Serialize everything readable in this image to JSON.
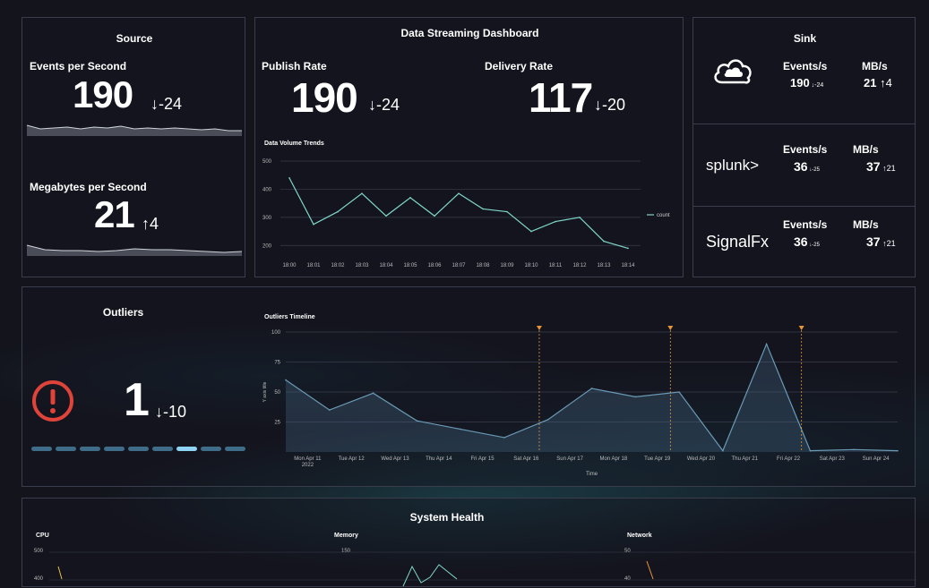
{
  "source": {
    "title": "Source",
    "eps_label": "Events per Second",
    "eps_value": "190",
    "eps_delta": "-24",
    "mbps_label": "Megabytes per Second",
    "mbps_value": "21",
    "mbps_delta": "4"
  },
  "dashboard": {
    "title": "Data Streaming Dashboard",
    "publish_label": "Publish Rate",
    "publish_value": "190",
    "publish_delta": "-24",
    "delivery_label": "Delivery Rate",
    "delivery_value": "117",
    "delivery_delta": "-20"
  },
  "sink": {
    "title": "Sink",
    "events_label": "Events/s",
    "mb_label": "MB/s",
    "rows": [
      {
        "name": "cloud-icon",
        "events": "190",
        "events_delta": "-24",
        "mb": "21",
        "mb_delta": "4"
      },
      {
        "name": "splunk>",
        "events": "36",
        "events_delta": "-25",
        "mb": "37",
        "mb_delta": "21"
      },
      {
        "name": "SignalFx",
        "events": "36",
        "events_delta": "-25",
        "mb": "37",
        "mb_delta": "21"
      }
    ]
  },
  "outliers": {
    "title": "Outliers",
    "value": "1",
    "delta": "-10",
    "icon": "alert-circle-icon",
    "dots_total": 9,
    "dots_active_index": 6
  },
  "system_health": {
    "title": "System Health",
    "cpu_label": "CPU",
    "cpu_ticks": [
      "500",
      "400"
    ],
    "memory_label": "Memory",
    "memory_ticks": [
      "150"
    ],
    "network_label": "Network",
    "network_ticks": [
      "50",
      "40"
    ]
  },
  "colors": {
    "accent": "#7fd6c8",
    "alert": "#e0433a",
    "dot": "#3f6c88",
    "dot_active": "#8fd3f4",
    "annotation": "#e8943a"
  },
  "chart_data": [
    {
      "type": "line",
      "title": "Data Volume Trends",
      "x": [
        "18:00",
        "18:01",
        "18:02",
        "18:03",
        "18:04",
        "18:05",
        "18:06",
        "18:07",
        "18:08",
        "18:09",
        "18:10",
        "18:11",
        "18:12",
        "18:13",
        "18:14"
      ],
      "series": [
        {
          "name": "count",
          "values": [
            440,
            275,
            320,
            385,
            305,
            370,
            305,
            385,
            330,
            320,
            250,
            285,
            300,
            215,
            190
          ]
        }
      ],
      "yticks": [
        "500",
        "400",
        "300",
        "200"
      ],
      "ylim": [
        150,
        500
      ],
      "legend": "right"
    },
    {
      "type": "area",
      "title": "Outliers Timeline",
      "xlabel": "Time",
      "ylabel": "Y axis title",
      "x": [
        "Mon Apr 11\n2022",
        "Tue Apr 12",
        "Wed Apr 13",
        "Thu Apr 14",
        "Fri Apr 15",
        "Sat Apr 16",
        "Sun Apr 17",
        "Mon Apr 18",
        "Tue Apr 19",
        "Wed Apr 20",
        "Thu Apr 21",
        "Fri Apr 22",
        "Sat Apr 23",
        "Sun Apr 24"
      ],
      "series": [
        {
          "values": [
            60,
            35,
            49,
            26,
            19,
            12,
            27,
            53,
            46,
            50,
            1,
            90,
            1,
            2,
            1
          ]
        }
      ],
      "yticks": [
        "100",
        "75",
        "50",
        "25"
      ],
      "ylim": [
        0,
        100
      ],
      "annotations_at": [
        5.8,
        8.8,
        11.8
      ]
    }
  ]
}
